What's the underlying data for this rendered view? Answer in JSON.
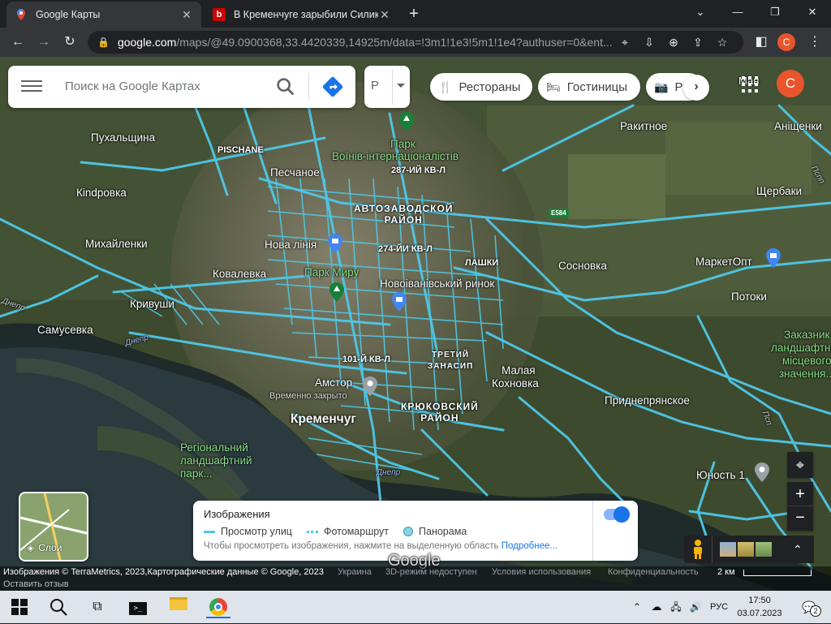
{
  "browser": {
    "tabs": [
      {
        "title": "Google Карты",
        "active": true,
        "icon": "google-maps-favicon"
      },
      {
        "title": "В Кременчуге зарыбили Силикатное",
        "active": false,
        "icon": "news-favicon"
      }
    ],
    "new_tab_symbol": "+",
    "address": {
      "domain": "google.com",
      "path": "/maps/@49.0900368,33.4420339,14925m/data=!3m1!1e3!5m1!1e4?authuser=0&ent..."
    },
    "profile_letter": "C"
  },
  "maps": {
    "search_placeholder": "Поиск на Google Картах",
    "profile_selector": "Р",
    "chips": [
      {
        "label": "Рестораны",
        "icon": "restaurant-icon"
      },
      {
        "label": "Гостиницы",
        "icon": "hotel-icon"
      },
      {
        "label": "Р",
        "icon": "camera-icon"
      }
    ],
    "overlay_text": "Ман",
    "avatar_letter": "C",
    "labels": [
      {
        "text": "Пухальщина"
      },
      {
        "text": "PISCHANE"
      },
      {
        "text": "Кindровка"
      },
      {
        "text": "Михайленки"
      },
      {
        "text": "Ковалевка"
      },
      {
        "text": "Кривуши"
      },
      {
        "text": "Самусевка"
      },
      {
        "text": "Песчаное"
      },
      {
        "text": "Нова лінія"
      },
      {
        "text": "Сосновка"
      },
      {
        "text": "Ракитное"
      },
      {
        "text": "Аніщенки"
      },
      {
        "text": "Щербаки"
      },
      {
        "text": "МаркетОпт"
      },
      {
        "text": "Потоки"
      },
      {
        "text": "Малая"
      },
      {
        "text": "Кохновка"
      },
      {
        "text": "Приднепрянское"
      },
      {
        "text": "Юность 1"
      },
      {
        "text": "Амстор"
      },
      {
        "text": "Временно закрыто"
      },
      {
        "text": "Кременчуг"
      },
      {
        "text": "Новоіванівський ринок"
      }
    ],
    "districts": [
      {
        "text": "АВТОЗАВОДСКОЙ"
      },
      {
        "text": "РАЙОН"
      },
      {
        "text": "КРЮКОВСКИЙ"
      },
      {
        "text": "РАЙОН"
      },
      {
        "text": "ТРЕТИЙ"
      },
      {
        "text": "ЗАНАСИП"
      },
      {
        "text": "287-ИЙ КВ-Л"
      },
      {
        "text": "274-ЙИ КВ-Л"
      },
      {
        "text": "101-Й КВ-Л"
      },
      {
        "text": "ЛАШКИ"
      }
    ],
    "parks": [
      {
        "text": "Парк"
      },
      {
        "text": "Воїнів-інтернаціоналістів"
      },
      {
        "text": "Парк Миру"
      },
      {
        "text": "Регіональний"
      },
      {
        "text": "ландшафтний"
      },
      {
        "text": "парк..."
      },
      {
        "text": "Заказник"
      },
      {
        "text": "ландшафтний"
      },
      {
        "text": "місцевого"
      },
      {
        "text": "значення..."
      }
    ],
    "water": [
      {
        "text": "Днепр"
      },
      {
        "text": "Днепр"
      }
    ],
    "road_labels": [
      {
        "text": "Пспп"
      },
      {
        "text": "Псп"
      },
      {
        "text": "Днепр"
      }
    ],
    "highway": "E584",
    "layers_label": "Слои",
    "legend": {
      "title": "Изображения",
      "items": [
        {
          "label": "Просмотр улиц"
        },
        {
          "label": "Фотомаршрут"
        },
        {
          "label": "Панорама"
        }
      ],
      "hint": "Чтобы просмотреть изображения, нажмите на выделенную область",
      "more": "Подробнее...",
      "toggle_on": true
    },
    "google_watermark": "Google",
    "footer": {
      "imagery": "Изображения © TerraMetrics, 2023,Картографические данные © Google, 2023",
      "country": "Украина",
      "threed": "3D-режим недоступен",
      "terms": "Условия использования",
      "privacy": "Конфиденциальность",
      "scale": "2 км",
      "feedback": "Оставить отзыв"
    },
    "zoom_in": "+",
    "zoom_out": "−"
  },
  "taskbar": {
    "lang": "РУС",
    "time": "17:50",
    "date": "03.07.2023",
    "notif_count": "2"
  },
  "colors": {
    "accent": "#1a73e8",
    "streetview": "#4ec8e8",
    "profile": "#e8552d"
  }
}
